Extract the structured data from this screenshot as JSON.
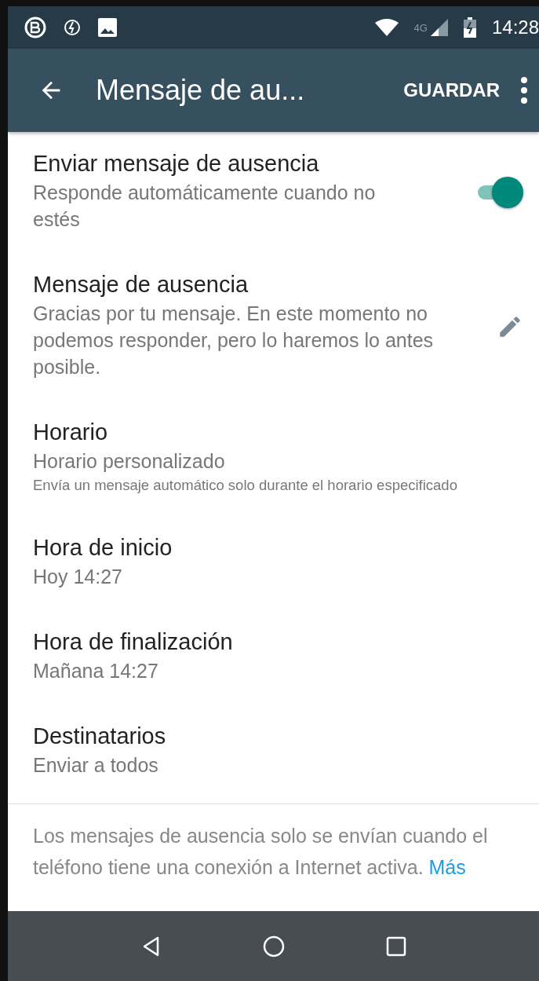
{
  "status_bar": {
    "time": "14:28",
    "network": "4G"
  },
  "toolbar": {
    "title": "Mensaje de au...",
    "action": "GUARDAR"
  },
  "settings": [
    {
      "kind": "toggle",
      "title": "Enviar mensaje de ausencia",
      "subtitle": "Responde automáticamente cuando no estés",
      "on": true
    },
    {
      "kind": "edit",
      "title": "Mensaje de ausencia",
      "subtitle": "Gracias por tu mensaje. En este momento no podemos responder, pero lo haremos lo antes posible."
    },
    {
      "kind": "plain",
      "title": "Horario",
      "subtitle": "Horario personalizado",
      "note": "Envía un mensaje automático solo durante el horario especificado"
    },
    {
      "kind": "plain",
      "title": "Hora de inicio",
      "subtitle": "Hoy 14:27"
    },
    {
      "kind": "plain",
      "title": "Hora de finalización",
      "subtitle": "Mañana 14:27"
    },
    {
      "kind": "plain",
      "title": "Destinatarios",
      "subtitle": "Enviar a todos"
    }
  ],
  "footer": {
    "text": "Los mensajes de ausencia solo se envían cuando el teléfono tiene una conexión a Internet activa.",
    "link": "Más"
  }
}
